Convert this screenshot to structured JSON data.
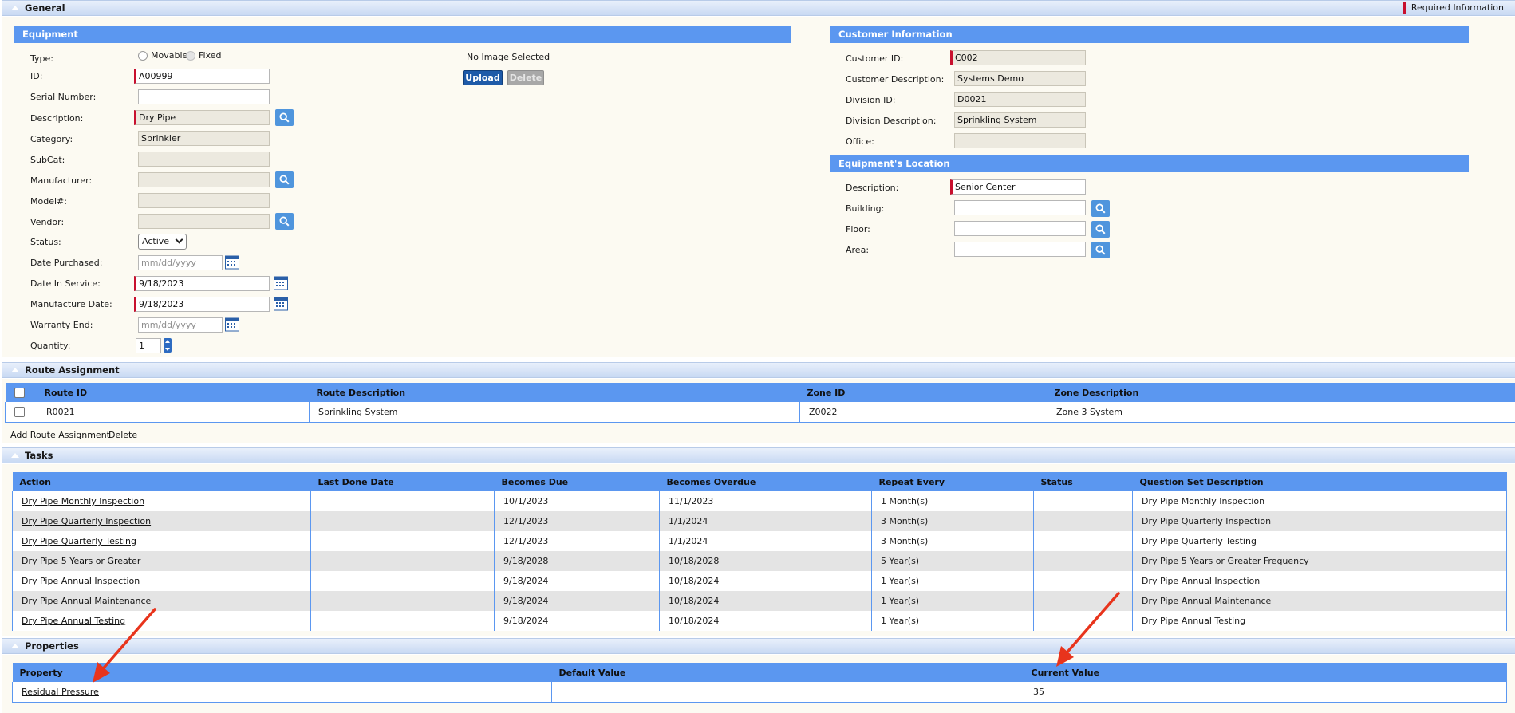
{
  "general": {
    "title": "General",
    "required_info": "Required Information",
    "equipment": {
      "panel_title": "Equipment",
      "type_label": "Type:",
      "type_options": [
        "Movable",
        "Fixed"
      ],
      "id_label": "ID:",
      "id_value": "A00999",
      "serial_label": "Serial Number:",
      "serial_value": "",
      "description_label": "Description:",
      "description_value": "Dry Pipe",
      "category_label": "Category:",
      "category_value": "Sprinkler",
      "subcat_label": "SubCat:",
      "manufacturer_label": "Manufacturer:",
      "model_label": "Model#:",
      "vendor_label": "Vendor:",
      "status_label": "Status:",
      "status_value": "Active",
      "date_purchased_label": "Date Purchased:",
      "date_purchased_placeholder": "mm/dd/yyyy",
      "date_in_service_label": "Date In Service:",
      "date_in_service_value": "9/18/2023",
      "manufacture_date_label": "Manufacture Date:",
      "manufacture_date_value": "9/18/2023",
      "warranty_end_label": "Warranty End:",
      "warranty_end_placeholder": "mm/dd/yyyy",
      "quantity_label": "Quantity:",
      "quantity_value": "1",
      "no_image": "No Image Selected",
      "upload_label": "Upload",
      "delete_label": "Delete"
    },
    "customer": {
      "panel_title": "Customer Information",
      "customer_id_label": "Customer ID:",
      "customer_id_value": "C002",
      "customer_desc_label": "Customer Description:",
      "customer_desc_value": "Systems Demo",
      "division_id_label": "Division ID:",
      "division_id_value": "D0021",
      "division_desc_label": "Division Description:",
      "division_desc_value": "Sprinkling System",
      "office_label": "Office:"
    },
    "location": {
      "panel_title": "Equipment's Location",
      "description_label": "Description:",
      "description_value": "Senior Center",
      "building_label": "Building:",
      "floor_label": "Floor:",
      "area_label": "Area:"
    }
  },
  "route": {
    "title": "Route Assignment",
    "columns": [
      "Route ID",
      "Route Description",
      "Zone ID",
      "Zone Description"
    ],
    "rows": [
      [
        "R0021",
        "Sprinkling System",
        "Z0022",
        "Zone 3 System"
      ]
    ],
    "add_label": "Add Route Assignment",
    "delete_label": "Delete"
  },
  "tasks": {
    "title": "Tasks",
    "columns": [
      "Action",
      "Last Done Date",
      "Becomes Due",
      "Becomes Overdue",
      "Repeat Every",
      "Status",
      "Question Set Description"
    ],
    "rows": [
      [
        "Dry Pipe Monthly Inspection",
        "",
        "10/1/2023",
        "11/1/2023",
        "1 Month(s)",
        "",
        "Dry Pipe Monthly Inspection"
      ],
      [
        "Dry Pipe Quarterly Inspection",
        "",
        "12/1/2023",
        "1/1/2024",
        "3 Month(s)",
        "",
        "Dry Pipe Quarterly Inspection"
      ],
      [
        "Dry Pipe Quarterly Testing",
        "",
        "12/1/2023",
        "1/1/2024",
        "3 Month(s)",
        "",
        "Dry Pipe Quarterly Testing"
      ],
      [
        "Dry Pipe 5 Years or Greater",
        "",
        "9/18/2028",
        "10/18/2028",
        "5 Year(s)",
        "",
        "Dry Pipe 5 Years or Greater Frequency"
      ],
      [
        "Dry Pipe Annual Inspection",
        "",
        "9/18/2024",
        "10/18/2024",
        "1 Year(s)",
        "",
        "Dry Pipe Annual Inspection"
      ],
      [
        "Dry Pipe Annual Maintenance",
        "",
        "9/18/2024",
        "10/18/2024",
        "1 Year(s)",
        "",
        "Dry Pipe Annual Maintenance"
      ],
      [
        "Dry Pipe Annual Testing",
        "",
        "9/18/2024",
        "10/18/2024",
        "1 Year(s)",
        "",
        "Dry Pipe Annual Testing"
      ]
    ]
  },
  "properties": {
    "title": "Properties",
    "columns": [
      "Property",
      "Default Value",
      "Current Value"
    ],
    "rows": [
      [
        "Residual Pressure",
        "",
        "35"
      ]
    ]
  },
  "colors": {
    "header_blue": "#5b97f0",
    "required_red": "#c8102e",
    "annotation_arrow": "#e8341c"
  }
}
